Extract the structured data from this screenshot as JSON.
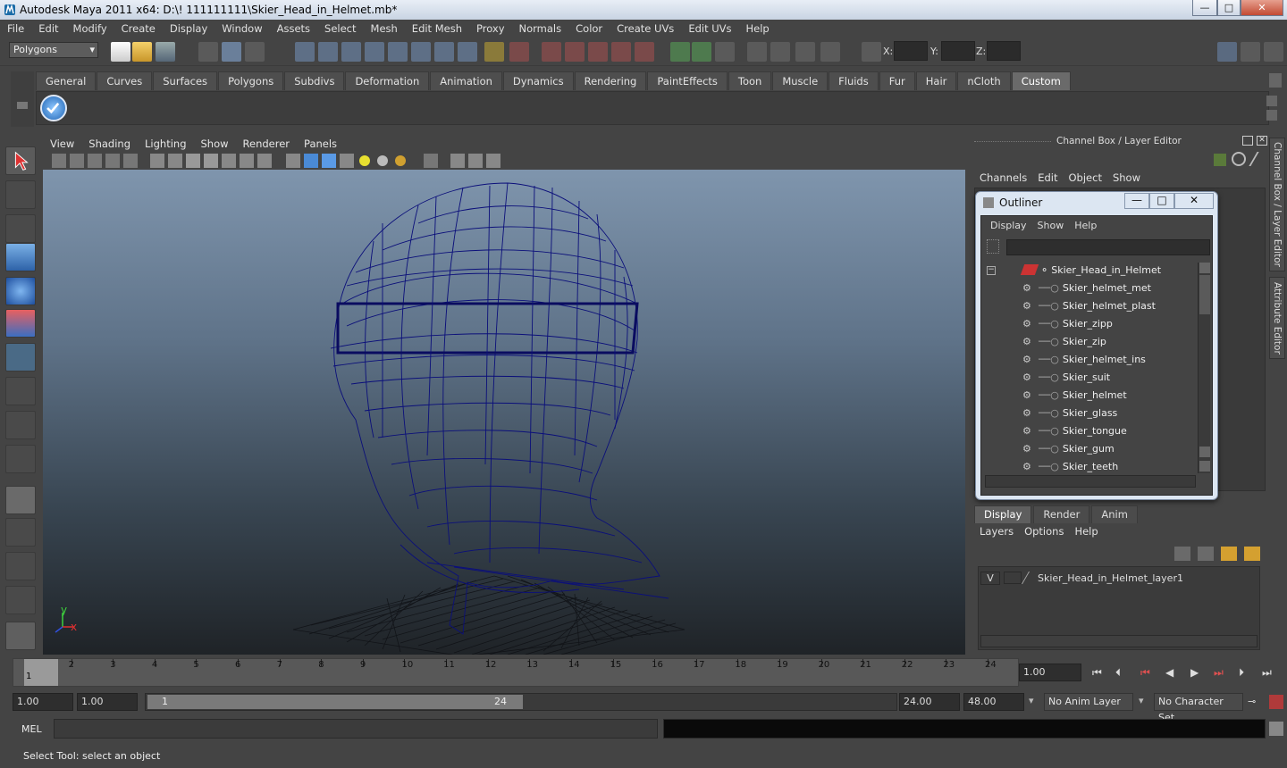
{
  "window": {
    "title": "Autodesk Maya 2011 x64: D:\\! 111111111\\Skier_Head_in_Helmet.mb*",
    "minimize": "—",
    "maximize": "□",
    "close": "✕"
  },
  "menubar": [
    "File",
    "Edit",
    "Modify",
    "Create",
    "Display",
    "Window",
    "Assets",
    "Select",
    "Mesh",
    "Edit Mesh",
    "Proxy",
    "Normals",
    "Color",
    "Create UVs",
    "Edit UVs",
    "Help"
  ],
  "statusline": {
    "mode": "Polygons",
    "x_label": "X:",
    "y_label": "Y:",
    "z_label": "Z:"
  },
  "shelf": {
    "tabs": [
      "General",
      "Curves",
      "Surfaces",
      "Polygons",
      "Subdivs",
      "Deformation",
      "Animation",
      "Dynamics",
      "Rendering",
      "PaintEffects",
      "Toon",
      "Muscle",
      "Fluids",
      "Fur",
      "Hair",
      "nCloth",
      "Custom"
    ],
    "active_tab": "Custom"
  },
  "viewport": {
    "menu": [
      "View",
      "Shading",
      "Lighting",
      "Show",
      "Renderer",
      "Panels"
    ],
    "axis_y": "y",
    "axis_x": "x",
    "wire_color": "#0b0f7a"
  },
  "channelbox": {
    "title": "Channel Box / Layer Editor",
    "menu": [
      "Channels",
      "Edit",
      "Object",
      "Show"
    ]
  },
  "sidetabs": {
    "tab1": "Channel Box / Layer Editor",
    "tab2": "Attribute Editor"
  },
  "outliner": {
    "title": "Outliner",
    "menu": [
      "Display",
      "Show",
      "Help"
    ],
    "root": "Skier_Head_in_Helmet",
    "items": [
      "Skier_helmet_met",
      "Skier_helmet_plast",
      "Skier_zipp",
      "Skier_zip",
      "Skier_helmet_ins",
      "Skier_suit",
      "Skier_helmet",
      "Skier_glass",
      "Skier_tongue",
      "Skier_gum",
      "Skier_teeth"
    ]
  },
  "layereditor": {
    "tabs": [
      "Display",
      "Render",
      "Anim"
    ],
    "active_tab": "Display",
    "menu": [
      "Layers",
      "Options",
      "Help"
    ],
    "layer_visible": "V",
    "layer_name": "Skier_Head_in_Helmet_layer1"
  },
  "timeline": {
    "ticks": [
      "1",
      "2",
      "3",
      "4",
      "5",
      "6",
      "7",
      "8",
      "9",
      "10",
      "11",
      "12",
      "13",
      "14",
      "15",
      "16",
      "17",
      "18",
      "19",
      "20",
      "21",
      "22",
      "23",
      "24"
    ],
    "current_frame_marker": "1",
    "current_time": "1.00"
  },
  "rangebar": {
    "start_time": "1.00",
    "playback_start": "1.00",
    "range_start_label": "1",
    "range_end_label": "24",
    "playback_end": "24.00",
    "end_time": "48.00",
    "anim_layer": "No Anim Layer",
    "character_set": "No Character Set"
  },
  "cmdline": {
    "label": "MEL"
  },
  "helpline": {
    "text": "Select Tool: select an object"
  }
}
